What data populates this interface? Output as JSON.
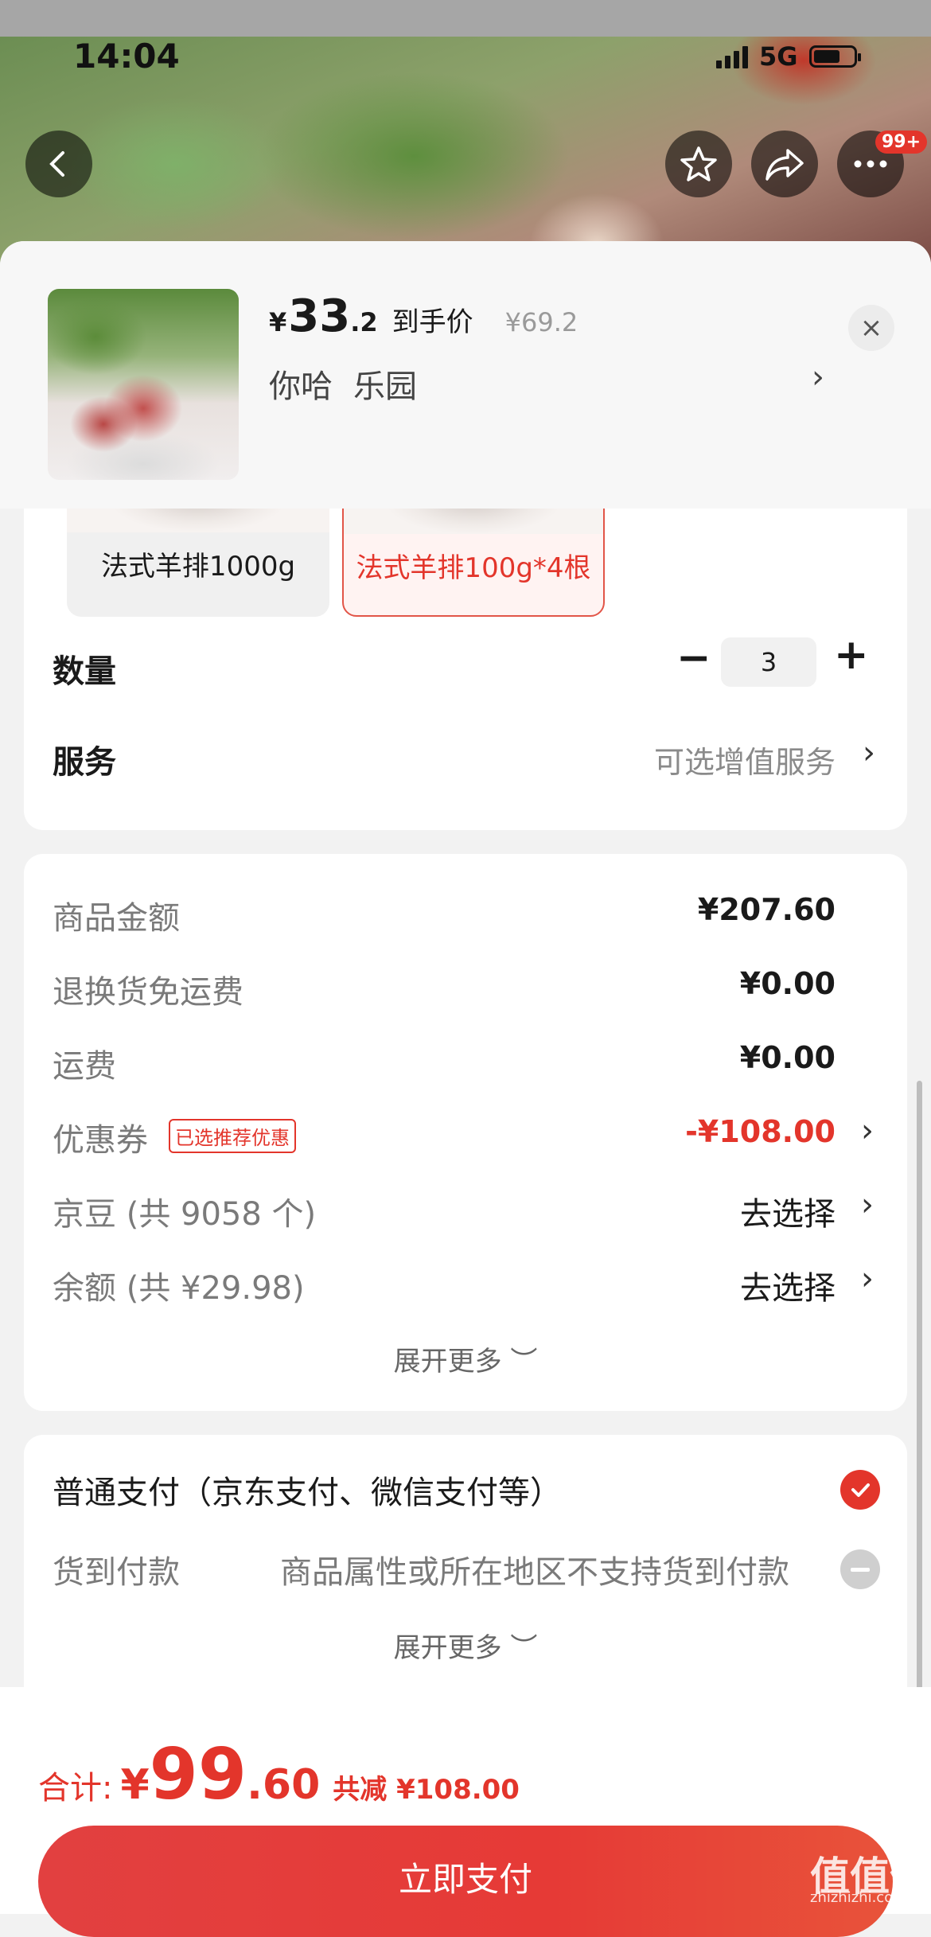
{
  "status_bar": {
    "time": "14:04",
    "network": "5G"
  },
  "header": {
    "badge": "99+"
  },
  "product": {
    "yen_symbol": "¥",
    "price_int": "33",
    "price_dec": ".2",
    "price_tag": "到手价",
    "original_price": "¥69.2",
    "address_part1": "你哈",
    "address_part2": "乐园",
    "arrow": "›",
    "close": "×"
  },
  "specs": {
    "options": [
      {
        "label": "法式羊排1000g",
        "selected": false
      },
      {
        "label": "法式羊排100g*4根",
        "selected": true
      }
    ]
  },
  "quantity": {
    "label": "数量",
    "minus": "−",
    "value": "3",
    "plus": "+"
  },
  "service": {
    "label": "服务",
    "value": "可选增值服务",
    "arrow": "›"
  },
  "fees": {
    "rows": [
      {
        "label": "商品金额",
        "value": "¥207.60"
      },
      {
        "label": "退换货免运费",
        "value": "¥0.00"
      },
      {
        "label": "运费",
        "value": "¥0.00"
      },
      {
        "label": "优惠券",
        "tag": "已选推荐优惠",
        "value": "-¥108.00",
        "arrow": "›"
      },
      {
        "label": "京豆 (共 9058 个)",
        "value": "去选择",
        "arrow": "›"
      },
      {
        "label": "余额 (共 ¥29.98)",
        "value": "去选择",
        "arrow": "›"
      }
    ],
    "expand": "展开更多 ︶"
  },
  "payment": {
    "option1": "普通支付（京东支付、微信支付等）",
    "option2": "货到付款",
    "option2_note": "商品属性或所在地区不支持货到付款",
    "expand": "展开更多 ︶"
  },
  "footer": {
    "total_label": "合计:",
    "yen": "¥",
    "total_int": "99",
    "total_dec": ".60",
    "saving": "共减 ¥108.00",
    "pay_button": "立即支付"
  },
  "watermark": {
    "logo": "值值值",
    "domain": "zhizhizhi.com"
  },
  "colors": {
    "accent": "#e3352b",
    "sheet_bg": "#f2f2f2"
  }
}
